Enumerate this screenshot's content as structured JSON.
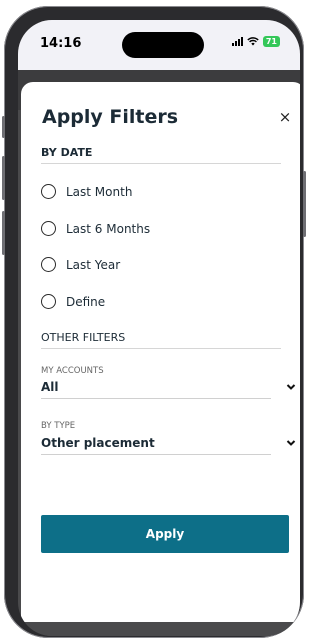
{
  "status_bar": {
    "time": "14:16",
    "battery": "71"
  },
  "sheet": {
    "title": "Apply Filters",
    "close_symbol": "×"
  },
  "by_date": {
    "heading": "BY DATE",
    "options": [
      {
        "label": "Last Month",
        "selected": false
      },
      {
        "label": "Last 6 Months",
        "selected": false
      },
      {
        "label": "Last Year",
        "selected": false
      },
      {
        "label": "Define",
        "selected": false
      }
    ]
  },
  "other_filters": {
    "heading": "OTHER FILTERS",
    "accounts": {
      "label": "MY ACCOUNTS",
      "value": "All"
    },
    "type": {
      "label": "BY TYPE",
      "value": "Other placement"
    }
  },
  "apply_button": {
    "label": "Apply"
  },
  "colors": {
    "accent": "#0d6f88",
    "battery": "#34c759",
    "title_text": "#1c2b36"
  }
}
